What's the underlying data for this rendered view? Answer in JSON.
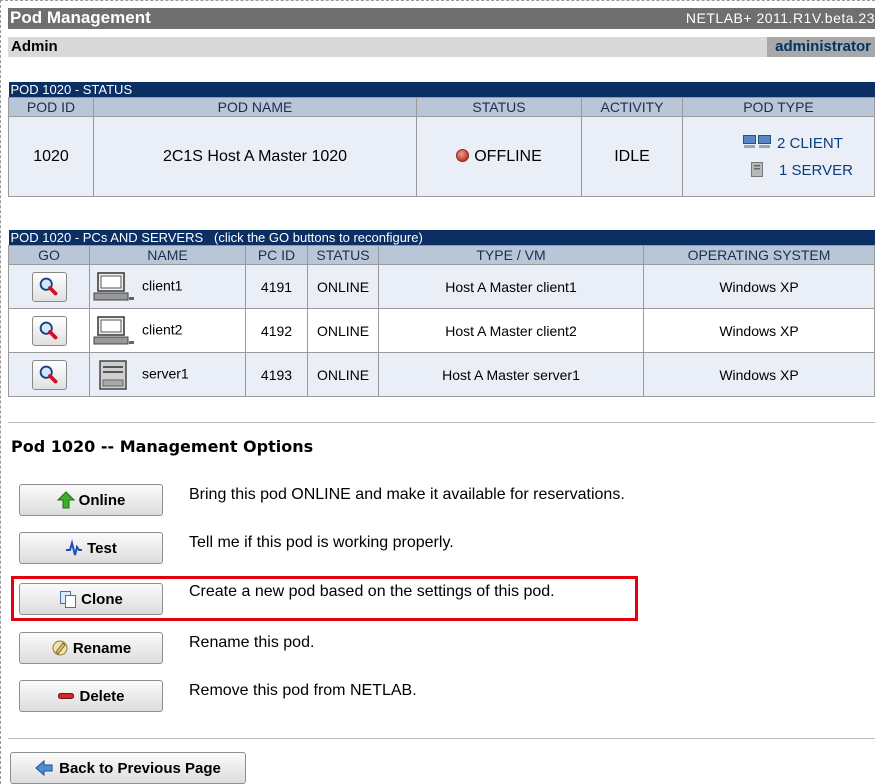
{
  "header": {
    "title": "Pod Management",
    "version": "NETLAB+ 2011.R1V.beta.23",
    "section": "Admin",
    "user": "administrator"
  },
  "status_table": {
    "section_title": "POD 1020 - STATUS",
    "columns": [
      "POD ID",
      "POD NAME",
      "STATUS",
      "ACTIVITY",
      "POD TYPE"
    ],
    "row": {
      "pod_id": "1020",
      "pod_name": "2C1S Host A Master 1020",
      "status": "OFFLINE",
      "activity": "IDLE",
      "type_client": "2 CLIENT",
      "type_server": "1 SERVER"
    }
  },
  "pc_table": {
    "section_title": "POD 1020 - PCs AND SERVERS   (click the GO buttons to reconfigure)",
    "columns": [
      "GO",
      "NAME",
      "PC ID",
      "STATUS",
      "TYPE / VM",
      "OPERATING SYSTEM"
    ],
    "rows": [
      {
        "name": "client1",
        "pc_id": "4191",
        "status": "ONLINE",
        "type_vm": "Host A Master client1",
        "os": "Windows XP",
        "kind": "client"
      },
      {
        "name": "client2",
        "pc_id": "4192",
        "status": "ONLINE",
        "type_vm": "Host A Master client2",
        "os": "Windows XP",
        "kind": "client"
      },
      {
        "name": "server1",
        "pc_id": "4193",
        "status": "ONLINE",
        "type_vm": "Host A Master server1",
        "os": "Windows XP",
        "kind": "server"
      }
    ]
  },
  "management": {
    "title": "Pod 1020 -- Management Options",
    "options": [
      {
        "label": "Online",
        "desc": "Bring this pod ONLINE and make it available for reservations.",
        "icon": "up-arrow-icon"
      },
      {
        "label": "Test",
        "desc": "Tell me if this pod is working properly.",
        "icon": "pulse-icon"
      },
      {
        "label": "Clone",
        "desc": "Create a new pod based on the settings of this pod.",
        "icon": "copy-icon"
      },
      {
        "label": "Rename",
        "desc": "Rename this pod.",
        "icon": "rename-icon"
      },
      {
        "label": "Delete",
        "desc": "Remove this pod from NETLAB.",
        "icon": "minus-icon"
      }
    ]
  },
  "back_button": {
    "label": "Back to Previous Page",
    "icon": "left-arrow-icon"
  },
  "colors": {
    "section_header": "#0b2f63",
    "column_header": "#b8c6d8",
    "row_alt": "#e9eef7",
    "highlight": "#e4000f",
    "pod_type_text": "#0b3f7a"
  }
}
